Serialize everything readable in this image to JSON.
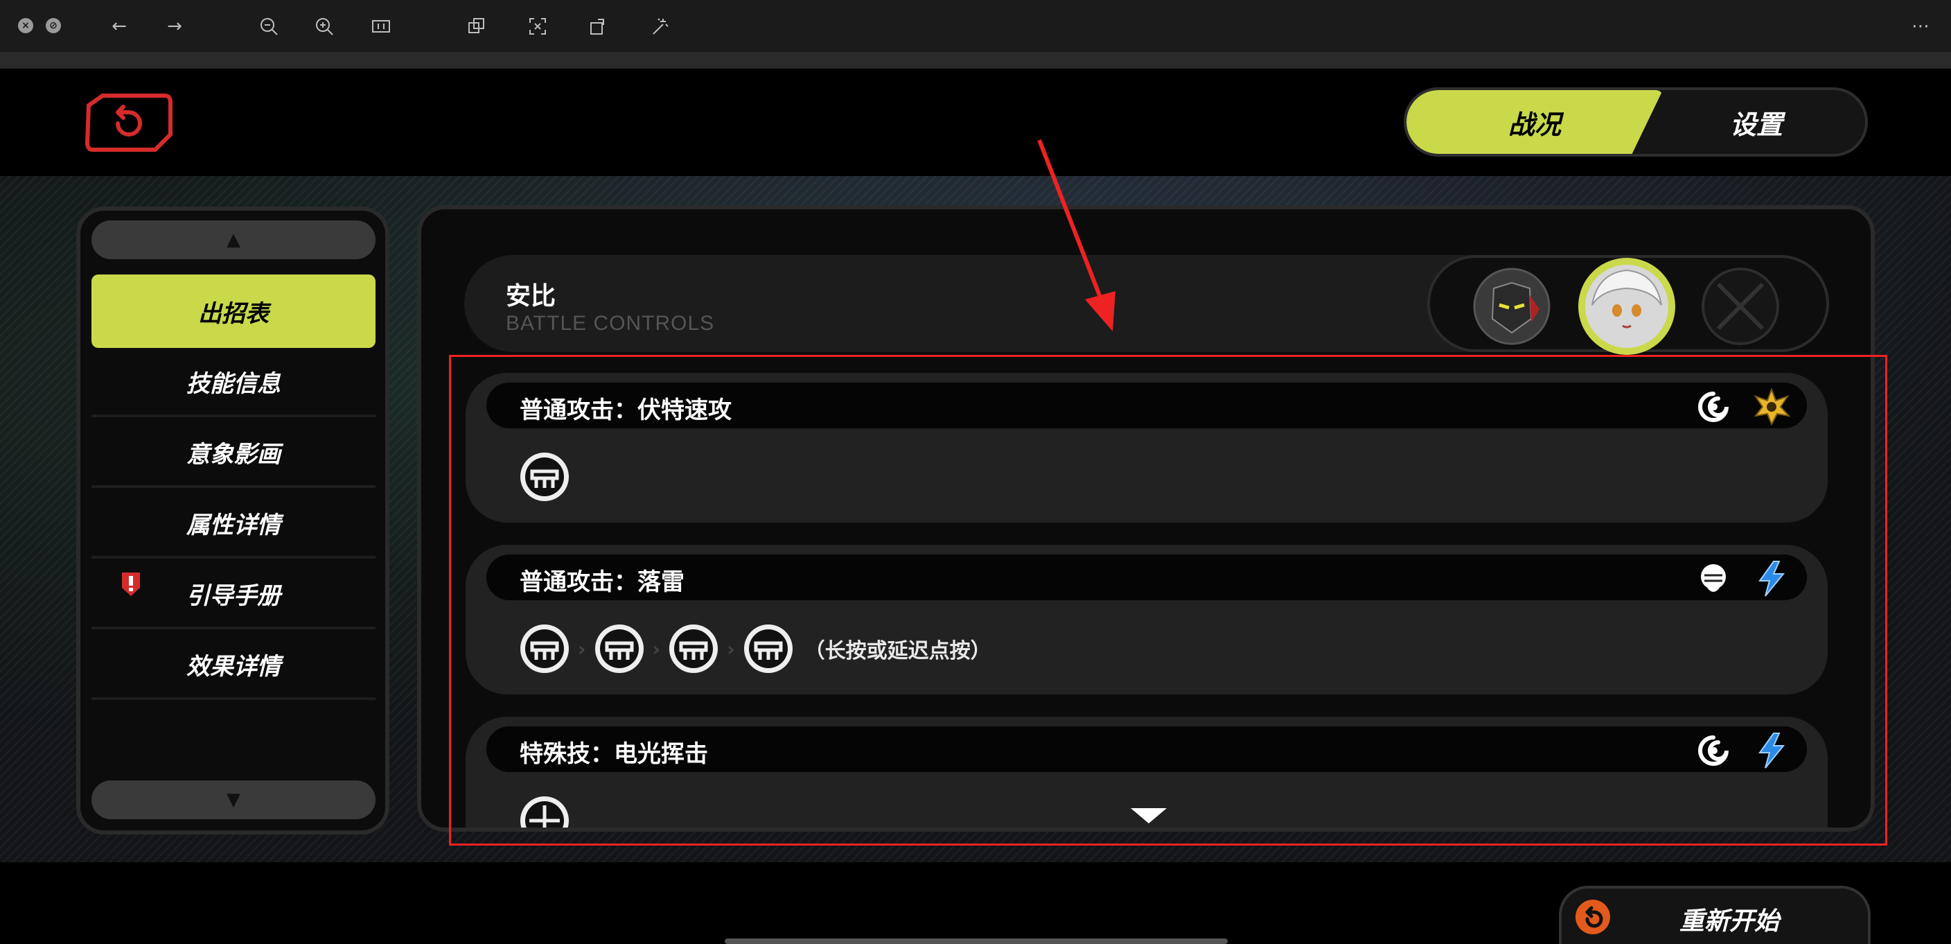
{
  "viewer": {
    "icons": [
      "close-circle-icon",
      "close-circle-icon",
      "back-arrow-icon",
      "forward-arrow-icon",
      "zoom-out-icon",
      "zoom-in-icon",
      "actual-size-icon",
      "copy-icon",
      "fit-icon",
      "rotate-icon",
      "magic-wand-icon",
      "more-icon"
    ]
  },
  "tabs": {
    "active": "战况",
    "inactive": "设置"
  },
  "sidebar": {
    "items": [
      {
        "label": "出招表",
        "active": true
      },
      {
        "label": "技能信息",
        "active": false
      },
      {
        "label": "意象影画",
        "active": false
      },
      {
        "label": "属性详情",
        "active": false
      },
      {
        "label": "引导手册",
        "active": false,
        "warning": true
      },
      {
        "label": "效果详情",
        "active": false
      }
    ]
  },
  "character": {
    "name": "安比",
    "subtitle": "BATTLE CONTROLS"
  },
  "moves": [
    {
      "title": "普通攻击：伏特速攻",
      "icons": [
        "swirl-icon",
        "burst-icon"
      ],
      "inputs": 1,
      "note": ""
    },
    {
      "title": "普通攻击：落雷",
      "icons": [
        "fist-icon",
        "electric-icon"
      ],
      "inputs": 4,
      "note": "（长按或延迟点按）"
    },
    {
      "title": "特殊技：电光挥击",
      "icons": [
        "swirl-icon",
        "electric-icon"
      ],
      "inputs": 1,
      "note": ""
    }
  ],
  "restart": {
    "label": "重新开始"
  },
  "colors": {
    "accent": "#cad94a",
    "annotation": "#ee2222",
    "backBtn": "#d62b2b"
  }
}
